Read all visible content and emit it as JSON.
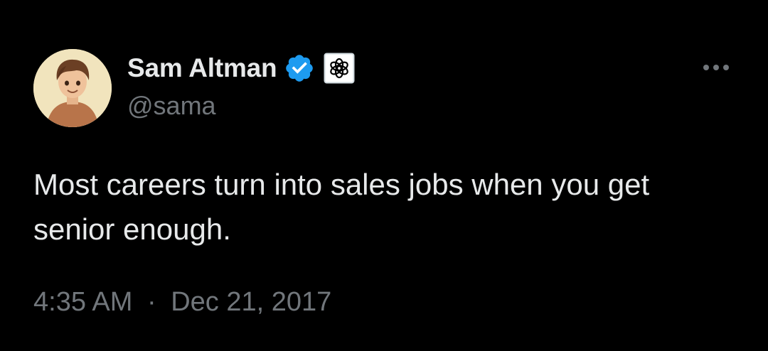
{
  "author": {
    "display_name": "Sam Altman",
    "handle": "@sama",
    "verified_badge_color": "#1d9bf0",
    "avatar_icon": "avatar-illustration",
    "affiliation_icon": "openai-logo-icon"
  },
  "tweet": {
    "text": "Most careers turn into sales jobs when you get senior enough.",
    "time": "4:35 AM",
    "separator": "·",
    "date": "Dec 21, 2017"
  },
  "theme": {
    "background": "#000000",
    "text_primary": "#e7e9ea",
    "text_secondary": "#71767b"
  },
  "actions": {
    "more_icon": "more-options-icon"
  }
}
